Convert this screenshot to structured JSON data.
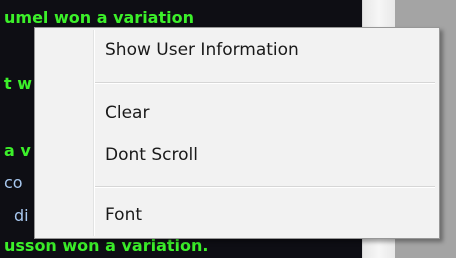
{
  "background_chat": {
    "lines": [
      {
        "text": "umel won a variation",
        "style": "green"
      },
      {
        "text": "t w",
        "style": "green"
      },
      {
        "text": "a v",
        "style": "green"
      },
      {
        "text": "co",
        "style": "blue"
      },
      {
        "text": "di",
        "style": "blue"
      },
      {
        "text": "usson won a variation.",
        "style": "green"
      }
    ]
  },
  "context_menu": {
    "items": [
      {
        "label": "Show User Information"
      },
      {
        "label": "Clear"
      },
      {
        "label": "Dont Scroll"
      },
      {
        "label": "Font"
      }
    ]
  },
  "colors": {
    "chat_background": "#0e0e14",
    "chat_green": "#3cf02a",
    "chat_blue": "#a8c8f0",
    "menu_background": "#f2f2f2",
    "menu_border": "#979797",
    "right_pane": "#a4a4a4"
  }
}
